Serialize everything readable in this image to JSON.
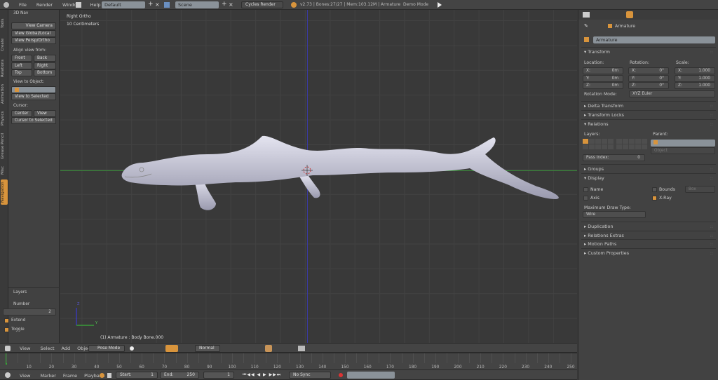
{
  "topbar": {
    "menus": [
      "File",
      "Render",
      "Window",
      "Help"
    ],
    "screen_layout": "Default",
    "scene": "Scene",
    "render_engine": "Cycles Render",
    "stats": "v2.73 | Bones:27/27 | Mem:103.12M | Armature",
    "demo_mode": "Demo Mode"
  },
  "toolshelf": {
    "tabs": [
      "Tools",
      "Create",
      "Relations",
      "Animation",
      "Physics",
      "Grease Pencil",
      "Misc",
      "Navigation"
    ],
    "active_tab": "Navigation",
    "panel_title": "3D Nav",
    "view_camera": "View Camera",
    "view_global_local": "View Global/Local",
    "view_persp_ortho": "View Persp/Ortho",
    "align_label": "Align view from:",
    "front": "Front",
    "back": "Back",
    "left": "Left",
    "right": "Right",
    "top": "Top",
    "bottom": "Bottom",
    "view_to_object_label": "View to Object:",
    "view_to_selected": "View to Selected",
    "cursor_label": "Cursor:",
    "center": "Center",
    "view": "View",
    "cursor_to_selected": "Cursor to Selected",
    "layers_title": "Layers",
    "number_label": "Number",
    "number_value": "2",
    "extend": "Extend",
    "toggle": "Toggle"
  },
  "viewport": {
    "view_name": "Right Ortho",
    "scale": "10 Centimeters",
    "object_info": "(1) Armature : Body Bone.000",
    "axis_x": "Y",
    "axis_z": "Z"
  },
  "viewport_header": {
    "menus": [
      "View",
      "Select",
      "Add",
      "Object"
    ],
    "mode": "Pose Mode",
    "pivot": "Normal"
  },
  "timeline": {
    "ticks": [
      10,
      20,
      30,
      40,
      50,
      60,
      70,
      80,
      90,
      100,
      110,
      120,
      130,
      140,
      150,
      160,
      170,
      180,
      190,
      200,
      210,
      220,
      230,
      240,
      250
    ],
    "current_frame": 0
  },
  "timeline_header": {
    "menus": [
      "View",
      "Marker",
      "Frame",
      "Playback"
    ],
    "start_label": "Start:",
    "start": "1",
    "end_label": "End:",
    "end": "250",
    "current": "1",
    "sync": "No Sync"
  },
  "properties": {
    "context": "Armature",
    "name": "Armature",
    "transform": {
      "title": "Transform",
      "location_label": "Location:",
      "rotation_label": "Rotation:",
      "scale_label": "Scale:",
      "location": [
        [
          "X:",
          "0m"
        ],
        [
          "Y:",
          "0m"
        ],
        [
          "Z:",
          "0m"
        ]
      ],
      "rotation": [
        [
          "X:",
          "0°"
        ],
        [
          "Y:",
          "0°"
        ],
        [
          "Z:",
          "0°"
        ]
      ],
      "scale": [
        [
          "X:",
          "1.000"
        ],
        [
          "Y:",
          "1.000"
        ],
        [
          "Z:",
          "1.000"
        ]
      ],
      "rotation_mode_label": "Rotation Mode:",
      "rotation_mode": "XYZ Euler"
    },
    "delta_transform": "Delta Transform",
    "transform_locks": "Transform Locks",
    "relations": {
      "title": "Relations",
      "layers_label": "Layers:",
      "parent_label": "Parent:",
      "parent_type": "Object",
      "pass_index_label": "Pass Index:",
      "pass_index": "0"
    },
    "groups": "Groups",
    "display": {
      "title": "Display",
      "name": "Name",
      "axis": "Axis",
      "bounds": "Bounds",
      "bounds_type": "Box",
      "xray": "X-Ray",
      "max_draw_label": "Maximum Draw Type:",
      "max_draw": "Wire"
    },
    "duplication": "Duplication",
    "relations_extras": "Relations Extras",
    "motion_paths": "Motion Paths",
    "custom_properties": "Custom Properties"
  },
  "colors": {
    "accent": "#d8943c",
    "x_axis": "#3a9a3a",
    "z_axis": "#3a3aa0"
  }
}
